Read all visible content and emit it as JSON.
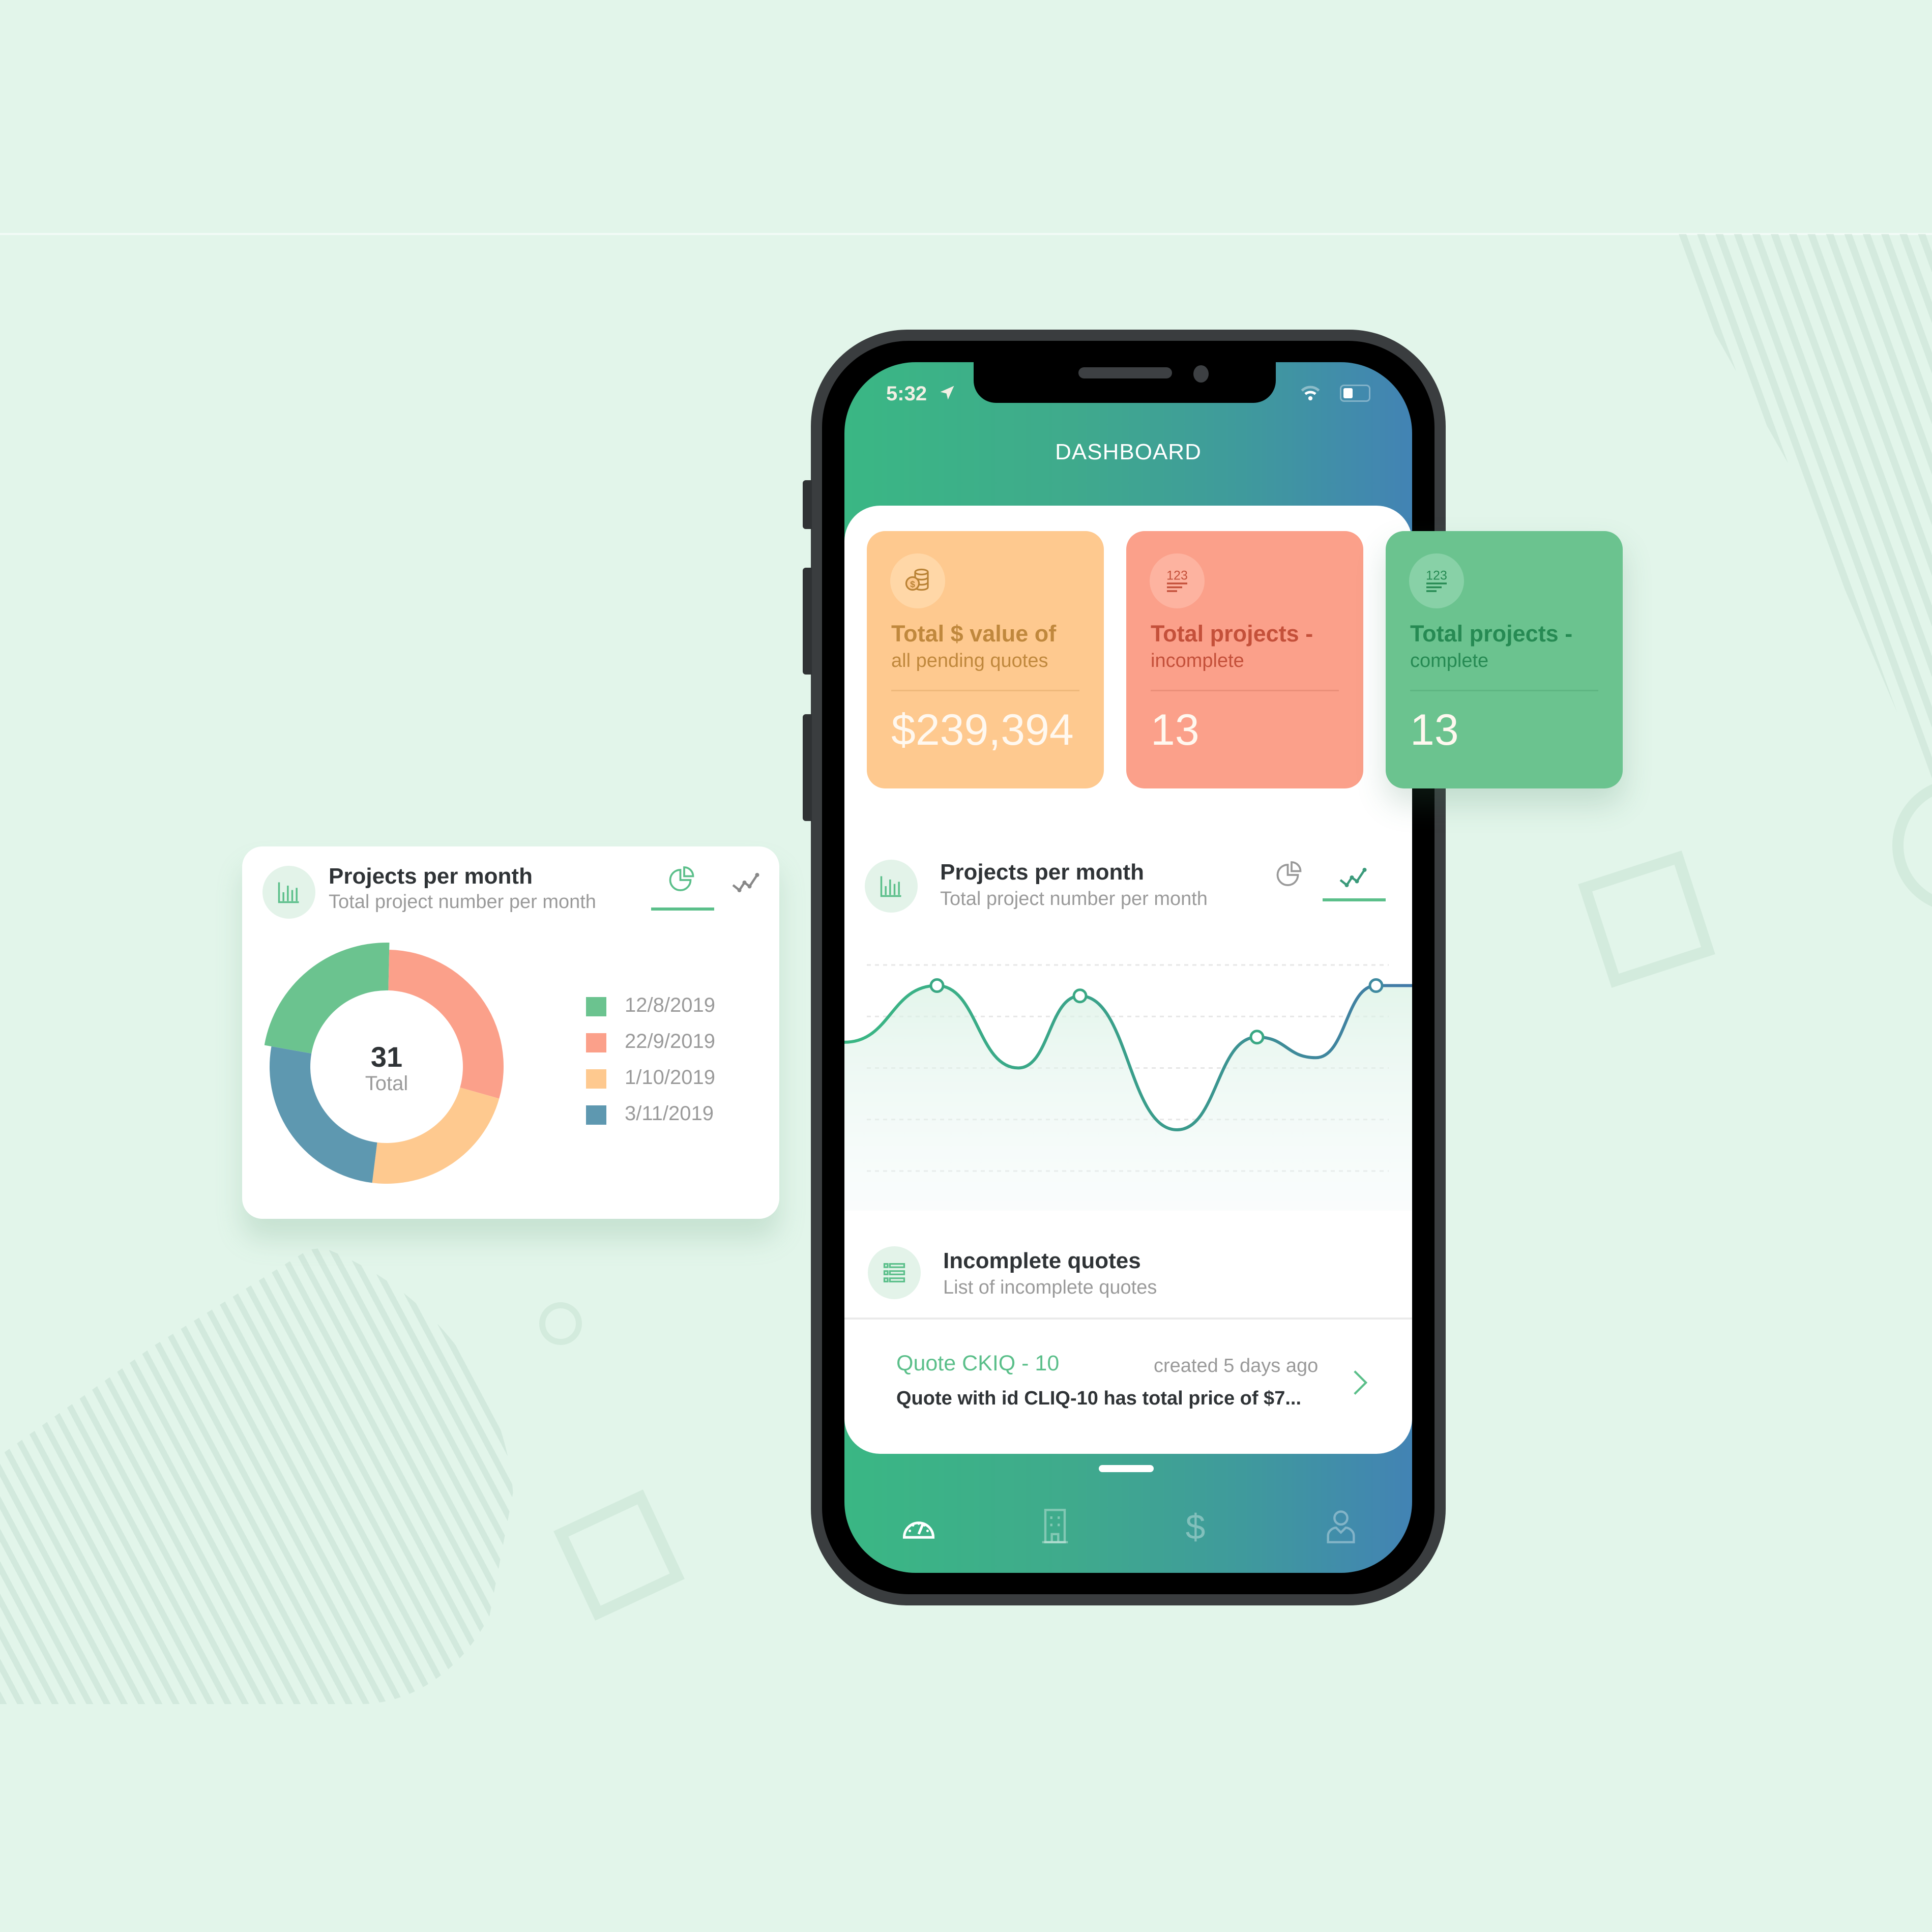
{
  "status_bar": {
    "time": "5:32"
  },
  "header": {
    "title": "DASHBOARD"
  },
  "stat_cards": [
    {
      "title": "Total $ value of",
      "subtitle": "all pending quotes",
      "value": "$239,394",
      "icon": "coins-icon",
      "color": "#fec98f"
    },
    {
      "title": "Total projects -",
      "subtitle": "incomplete",
      "value": "13",
      "icon": "numbers-icon",
      "color": "#fba08a"
    },
    {
      "title": "Total projects -",
      "subtitle": "complete",
      "value": "13",
      "icon": "numbers-icon",
      "color": "#6bc38f"
    }
  ],
  "projects_section": {
    "title": "Projects per month",
    "subtitle": "Total project number per month",
    "views": [
      "pie",
      "line"
    ],
    "active_view_phone": "line",
    "active_view_card": "pie"
  },
  "quotes_section": {
    "title": "Incomplete quotes",
    "subtitle": "List of incomplete quotes",
    "items": [
      {
        "title": "Quote CKIQ - 10",
        "created": "created 5 days ago",
        "description": "Quote with id CLIQ-10 has total price of $7..."
      }
    ]
  },
  "bottom_nav": [
    {
      "name": "dashboard",
      "icon": "speedometer-icon",
      "active": true
    },
    {
      "name": "projects",
      "icon": "building-icon",
      "active": false
    },
    {
      "name": "quotes",
      "icon": "dollar-icon",
      "active": false
    },
    {
      "name": "profile",
      "icon": "user-icon",
      "active": false
    }
  ],
  "chart_data": [
    {
      "type": "line",
      "title": "Projects per month",
      "subtitle": "Total project number per month",
      "x": [
        0,
        1,
        2,
        3,
        4,
        5,
        6,
        7,
        8
      ],
      "series": [
        {
          "name": "Projects",
          "values": [
            2.5,
            3.6,
            2.0,
            3.4,
            0.8,
            2.6,
            2.2,
            3.6,
            3.6
          ],
          "markers": [
            false,
            true,
            false,
            true,
            false,
            true,
            false,
            true,
            false
          ]
        }
      ],
      "ylim": [
        0,
        4
      ],
      "grid": true,
      "colors": {
        "start": "#3ab784",
        "end": "#4283b4"
      }
    },
    {
      "type": "pie",
      "title": "Projects per month",
      "subtitle": "Total project number per month",
      "donut": true,
      "center_value": "31",
      "center_label": "Total",
      "categories": [
        "12/8/2019",
        "22/9/2019",
        "1/10/2019",
        "3/11/2019"
      ],
      "values": [
        7,
        9,
        7,
        8
      ],
      "colors": [
        "#6bc38f",
        "#fba08a",
        "#fec98f",
        "#5e98b0"
      ],
      "legend": "right"
    }
  ]
}
